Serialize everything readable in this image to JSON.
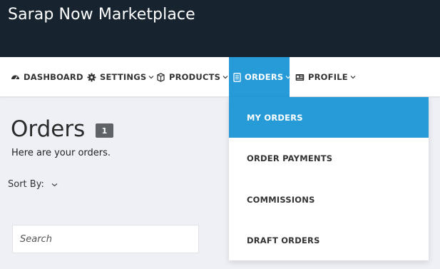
{
  "app": {
    "title": "Sarap Now Marketplace"
  },
  "nav": {
    "items": [
      {
        "label": "DASHBOARD",
        "icon": "dashboard-icon",
        "has_dropdown": false
      },
      {
        "label": "SETTINGS",
        "icon": "gear-icon",
        "has_dropdown": true
      },
      {
        "label": "PRODUCTS",
        "icon": "box-icon",
        "has_dropdown": true
      },
      {
        "label": "ORDERS",
        "icon": "document-icon",
        "has_dropdown": true,
        "active": true
      },
      {
        "label": "PROFILE",
        "icon": "id-card-icon",
        "has_dropdown": true
      }
    ]
  },
  "orders_menu": {
    "items": [
      {
        "label": "MY ORDERS",
        "active": true
      },
      {
        "label": "ORDER PAYMENTS"
      },
      {
        "label": "COMMISSIONS"
      },
      {
        "label": "DRAFT ORDERS"
      }
    ]
  },
  "page": {
    "title": "Orders",
    "count": "1",
    "subtitle": "Here are your orders.",
    "sort_label": "Sort By:",
    "search_placeholder": "Search"
  },
  "colors": {
    "header_bg": "#17242f",
    "accent": "#269bd8",
    "page_bg": "#eef0f6"
  }
}
